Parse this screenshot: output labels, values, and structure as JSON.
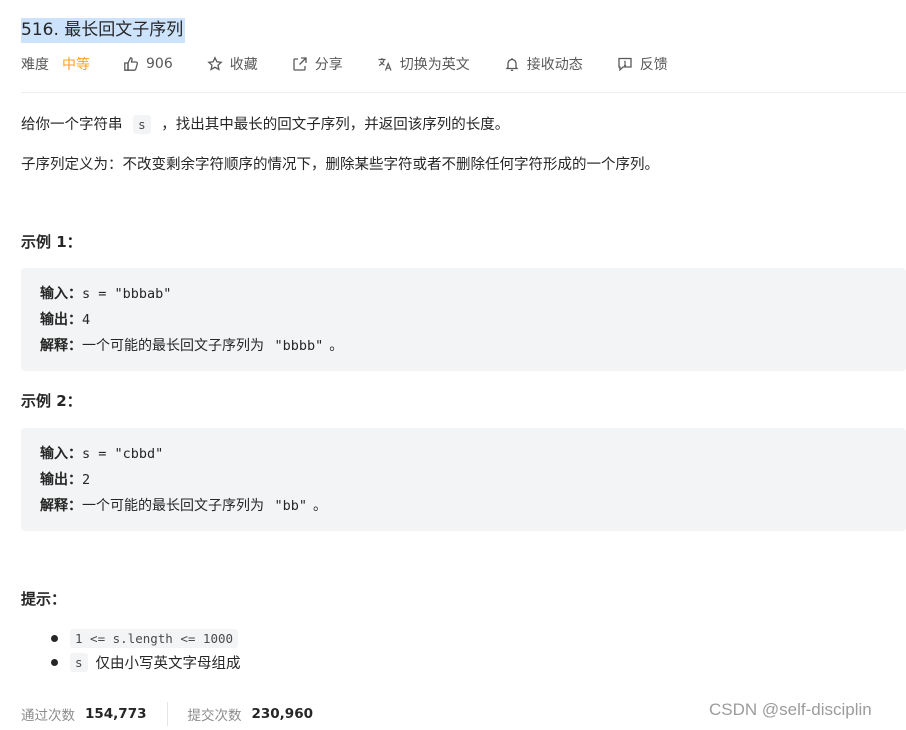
{
  "problem": {
    "title": "516. 最长回文子序列"
  },
  "toolbar": {
    "difficulty_label": "难度",
    "difficulty_value": "中等",
    "difficulty_color": "#ffa116",
    "likes": "906",
    "favorite": "收藏",
    "share": "分享",
    "switch_lang": "切换为英文",
    "notify": "接收动态",
    "feedback": "反馈"
  },
  "description": {
    "p1_before": "给你一个字符串",
    "p1_code": "s",
    "p1_after": "，找出其中最长的回文子序列，并返回该序列的长度。",
    "p2": "子序列定义为：不改变剩余字符顺序的情况下，删除某些字符或者不删除任何字符形成的一个序列。"
  },
  "examples": [
    {
      "heading": "示例 1：",
      "input_label": "输入：",
      "input_value": "s = \"bbbab\"",
      "output_label": "输出：",
      "output_value": "4",
      "explain_label": "解释：",
      "explain_text": "一个可能的最长回文子序列为",
      "explain_code": "\"bbbb\"",
      "explain_end": "。"
    },
    {
      "heading": "示例 2：",
      "input_label": "输入：",
      "input_value": "s = \"cbbd\"",
      "output_label": "输出：",
      "output_value": "2",
      "explain_label": "解释：",
      "explain_text": "一个可能的最长回文子序列为",
      "explain_code": "\"bb\"",
      "explain_end": "。"
    }
  ],
  "tips": {
    "heading": "提示：",
    "items": [
      {
        "code": "1 <= s.length <= 1000",
        "text": ""
      },
      {
        "code": "s",
        "text": "仅由小写英文字母组成"
      }
    ]
  },
  "stats": {
    "accepted_label": "通过次数",
    "accepted_value": "154,773",
    "submitted_label": "提交次数",
    "submitted_value": "230,960"
  },
  "watermark": "CSDN @self-disciplin"
}
